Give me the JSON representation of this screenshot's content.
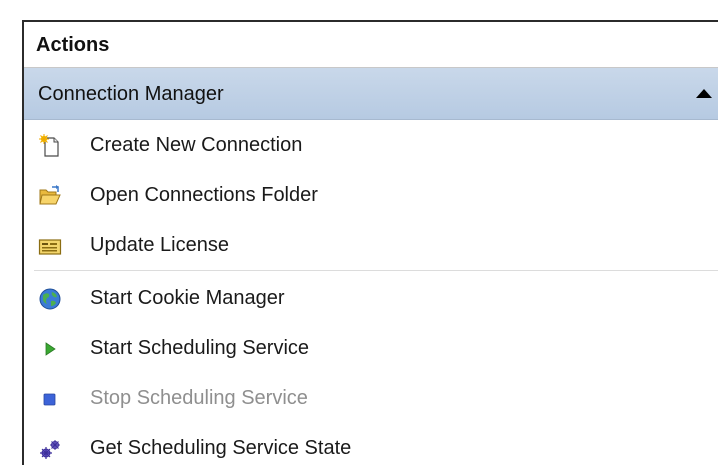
{
  "panel": {
    "title": "Actions"
  },
  "section": {
    "title": "Connection Manager",
    "collapse_icon": "triangle-up-icon"
  },
  "items": [
    {
      "label": "Create New Connection",
      "icon": "new-document-icon",
      "enabled": true
    },
    {
      "label": "Open Connections Folder",
      "icon": "folder-open-icon",
      "enabled": true
    },
    {
      "label": "Update License",
      "icon": "license-icon",
      "enabled": true
    },
    {
      "label": "Start Cookie Manager",
      "icon": "globe-icon",
      "enabled": true
    },
    {
      "label": "Start Scheduling Service",
      "icon": "play-icon",
      "enabled": true
    },
    {
      "label": "Stop Scheduling Service",
      "icon": "stop-icon",
      "enabled": false
    },
    {
      "label": "Get Scheduling Service State",
      "icon": "gears-icon",
      "enabled": true
    }
  ],
  "colors": {
    "section_header": "#b6cae2",
    "disabled_text": "#8f8f8f",
    "play_green": "#3aa832",
    "stop_blue": "#3c63d8"
  }
}
